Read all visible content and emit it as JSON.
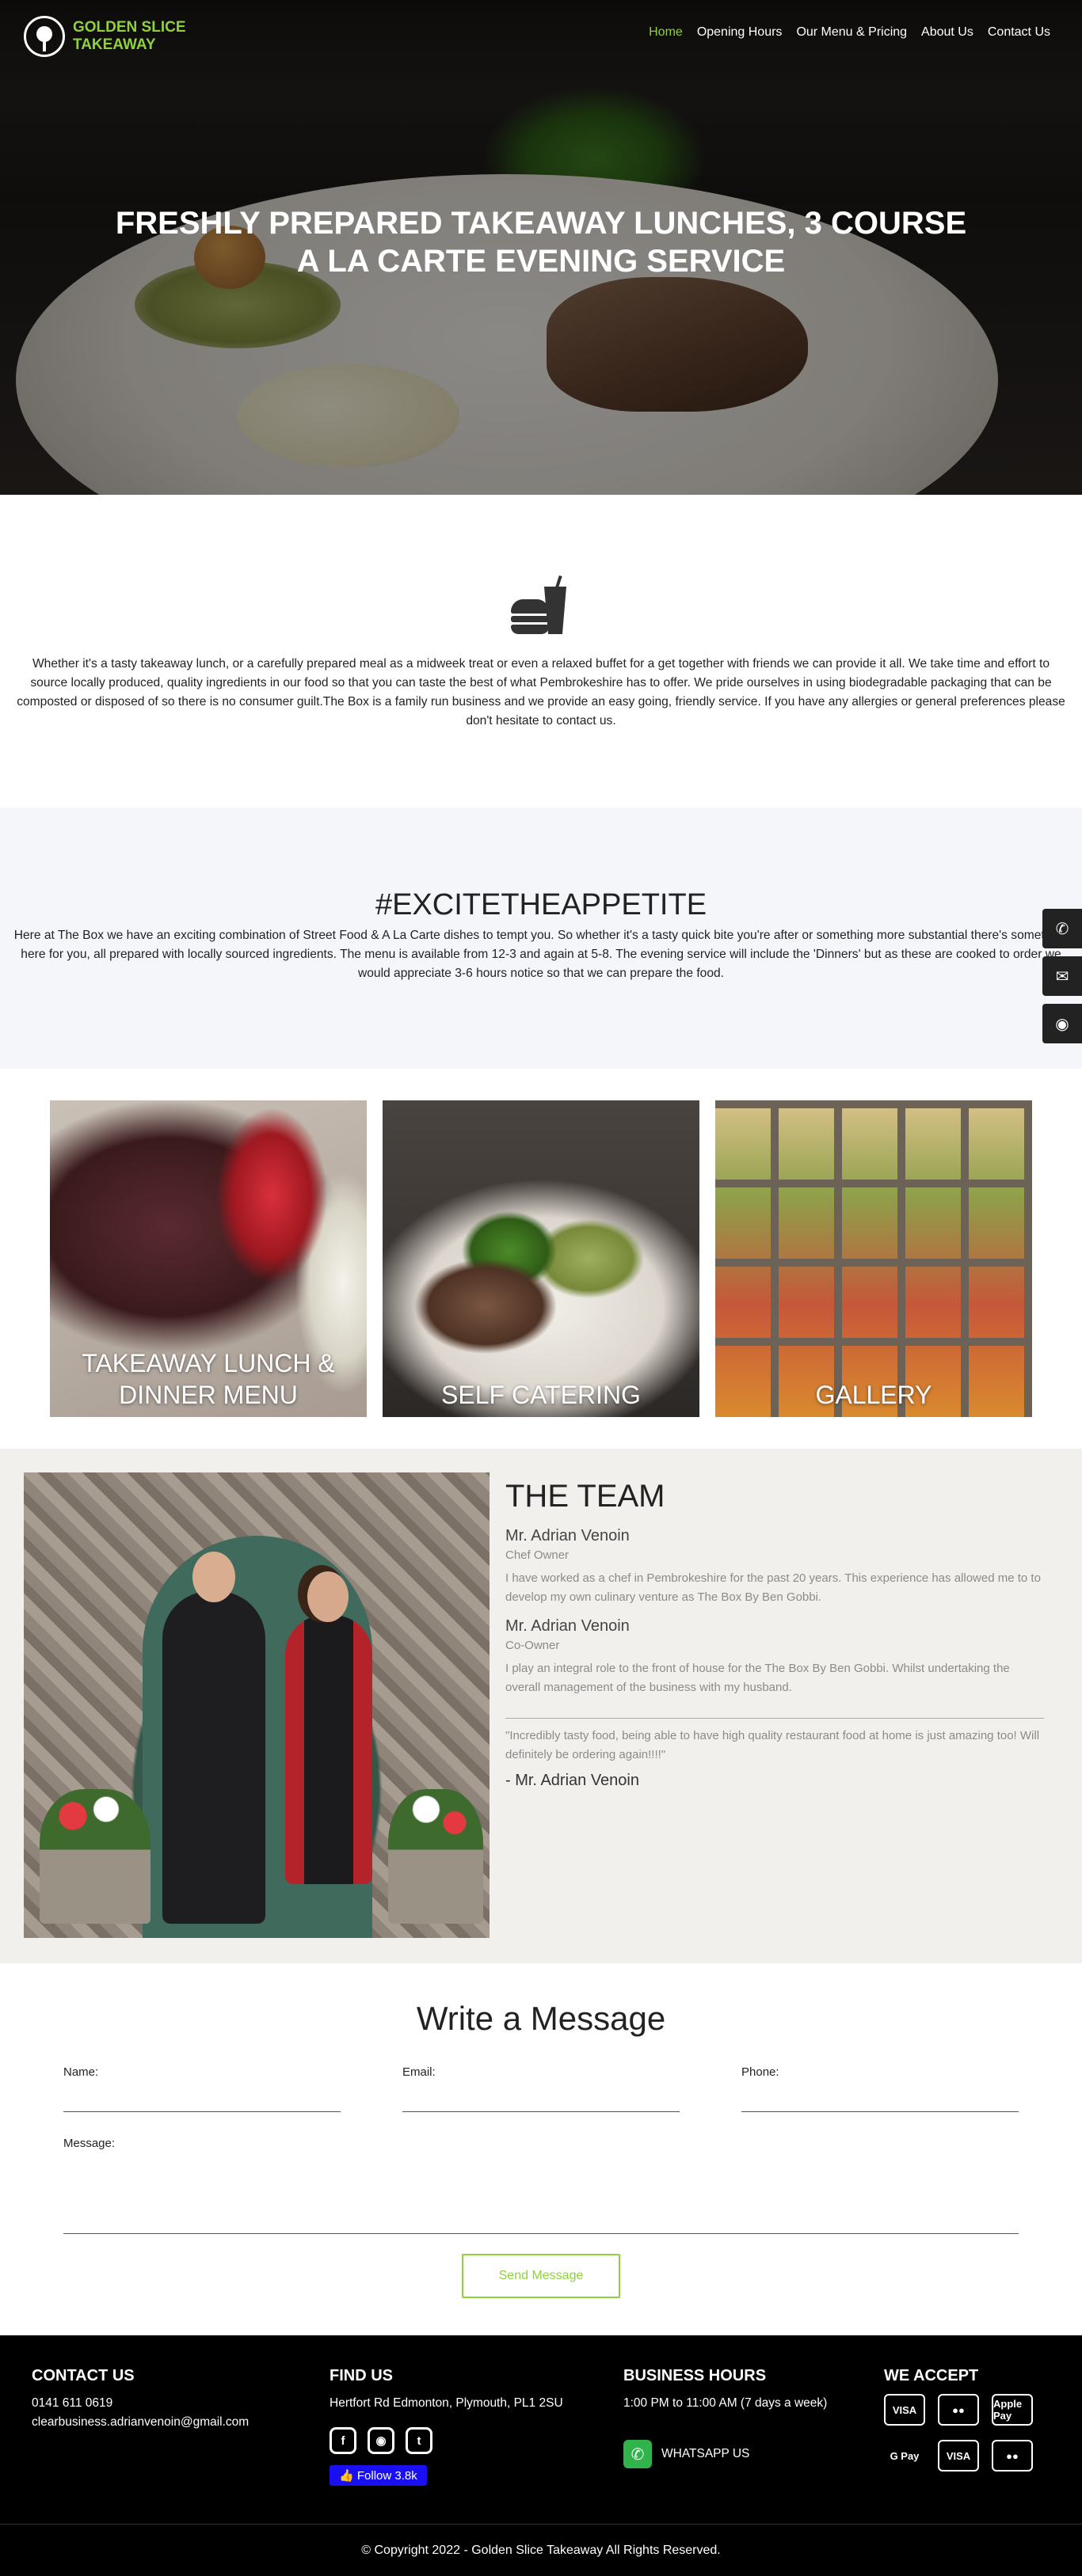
{
  "brand": {
    "name": "Golden Slice Takeaway",
    "line1": "GOLDEN SLICE",
    "line2": "TAKEAWAY",
    "accent": "#8fd13d"
  },
  "nav": [
    {
      "label": "Home",
      "active": true
    },
    {
      "label": "Opening Hours",
      "active": false
    },
    {
      "label": "Our Menu & Pricing",
      "active": false
    },
    {
      "label": "About Us",
      "active": false
    },
    {
      "label": "Contact Us",
      "active": false
    }
  ],
  "hero": {
    "line1": "FRESHLY PREPARED TAKEAWAY LUNCHES, 3 COURSE",
    "line2": "A LA CARTE EVENING SERVICE"
  },
  "intro": {
    "icon": "burger-drink-icon",
    "text": "Whether it's a tasty takeaway lunch, or a carefully prepared meal as a midweek treat or even a relaxed buffet for a get together with friends we can provide it all. We take time and effort to source locally produced, quality ingredients in our food so that you can taste the best of what Pembrokeshire has to offer. We pride ourselves in using biodegradable packaging that can be composted or disposed of so there is no consumer guilt.The Box is a family run business and we provide an easy going, friendly service. If you have any allergies or general preferences please don't hesitate to contact us."
  },
  "excite": {
    "title": "#EXCITETHEAPPETITE",
    "text": "Here at The Box we have an exciting combination of Street Food & A La Carte dishes to tempt you. So whether it's a tasty quick bite you're after or something more substantial there's something here for you, all prepared with locally sourced ingredients. The menu is available from 12-3 and again at 5-8. The evening service will include the 'Dinners' but as these are cooked to order we would appreciate 3-6 hours notice so that we can prepare the food."
  },
  "side_tools": [
    "phone-icon",
    "mail-icon",
    "location-pin-icon"
  ],
  "cards": [
    {
      "label": "TAKEAWAY LUNCH & DINNER MENU"
    },
    {
      "label": "SELF CATERING"
    },
    {
      "label": "GALLERY"
    }
  ],
  "team": {
    "title": "THE TEAM",
    "members": [
      {
        "name": "Mr. Adrian Venoin",
        "role": "Chef Owner",
        "bio": "I have worked as a chef in Pembrokeshire for the past 20 years. This experience has allowed me to to develop my own culinary venture as The Box By Ben Gobbi."
      },
      {
        "name": "Mr. Adrian Venoin",
        "role": "Co-Owner",
        "bio": "I play an integral role to the front of house for the The Box By Ben Gobbi. Whilst undertaking the overall management of the business with my husband."
      }
    ],
    "quote": "\"Incredibly tasty food, being able to have high quality restaurant food at home is just amazing too! Will definitely be ordering again!!!!\"",
    "quote_author": "- Mr. Adrian Venoin"
  },
  "form": {
    "title": "Write a Message",
    "name_label": "Name:",
    "name_value": "",
    "email_label": "Email:",
    "email_value": "",
    "phone_label": "Phone:",
    "phone_value": "",
    "message_label": "Message:",
    "message_value": "",
    "send_label": "Send Message"
  },
  "footer": {
    "contact": {
      "title": "CONTACT US",
      "phone": "0141 611 0619",
      "email": "clearbusiness.adrianvenoin@gmail.com"
    },
    "find": {
      "title": "FIND US",
      "address": "Hertfort Rd Edmonton, Plymouth, PL1 2SU",
      "social": [
        "facebook-icon",
        "instagram-icon",
        "twitter-icon"
      ],
      "follow": "Follow 3.8k"
    },
    "hours": {
      "title": "BUSINESS HOURS",
      "text": "1:00 PM to 11:00 AM (7 days a week)",
      "whatsapp": "WHATSAPP US"
    },
    "accept": {
      "title": "WE ACCEPT",
      "methods": [
        "VISA",
        "MasterCard",
        "Apple Pay",
        "G Pay",
        "VISA",
        "MasterCard"
      ]
    },
    "copyright": "© Copyright 2022 - Golden Slice Takeaway All Rights Reserved."
  }
}
